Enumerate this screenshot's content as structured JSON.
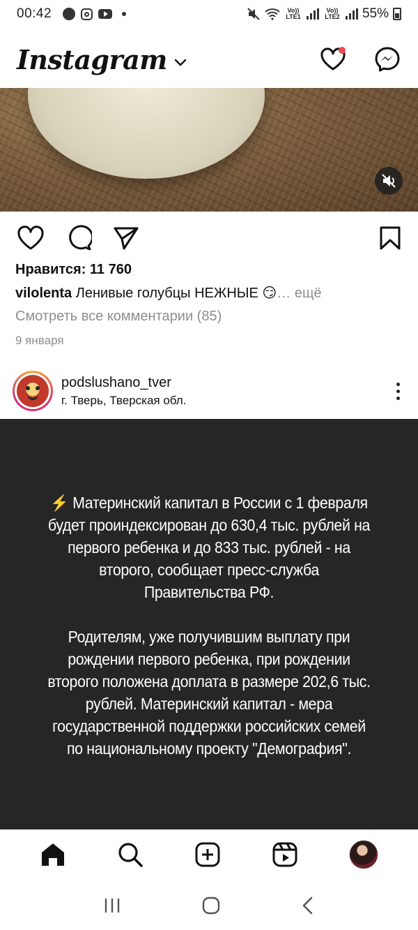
{
  "status_bar": {
    "time": "00:42",
    "lte1": "Vo)) LTE1",
    "lte2": "Vo)) LTE2",
    "battery": "55%"
  },
  "header": {
    "logo": "Instagram",
    "icons": [
      "chevron-down-icon",
      "heart-icon",
      "messenger-icon"
    ],
    "notification_color": "#ed4956"
  },
  "post1": {
    "media_overlay_icon": "volume-off-icon",
    "likes": "Нравится: 11 760",
    "caption_user": "vilolenta",
    "caption_text": " Ленивые голубцы НЕЖНЫЕ 😏",
    "caption_more": "… ещё",
    "comments_link": "Смотреть все комментарии (85)",
    "date": "9 января"
  },
  "post2": {
    "username": "podslushano_tver",
    "location": "г. Тверь, Тверская обл.",
    "paragraph1_icon": "⚡",
    "paragraph1": "Материнский капитал в России с 1 февраля будет проиндексирован до 630,4 тыс. рублей на первого ребенка и до 833 тыс. рублей - на второго, сообщает пресс-служба Правительства РФ.",
    "paragraph2": "Родителям, уже получившим выплату при рождении первого ребенка, при рождении второго положена доплата в размере 202,6 тыс. рублей. Материнский капитал - мера государственной поддержки российских семей по национальному проекту \"Демография\"."
  },
  "bottom_nav": {
    "items": [
      "home-icon",
      "search-icon",
      "new-post-icon",
      "reels-icon",
      "profile-avatar"
    ]
  },
  "system_nav": [
    "recent-apps-icon",
    "home-button-icon",
    "back-icon"
  ],
  "colors": {
    "dark_post_bg": "#262626",
    "secondary_text": "#8e8e8e"
  }
}
